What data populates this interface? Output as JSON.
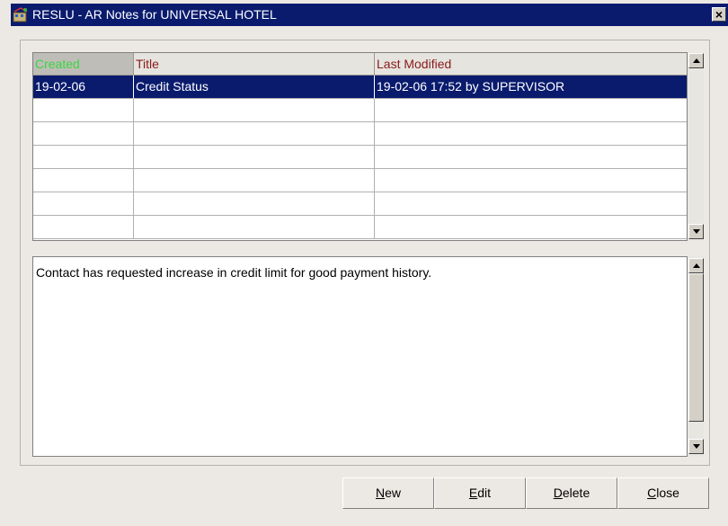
{
  "window": {
    "title": "RESLU - AR Notes for UNIVERSAL HOTEL",
    "close_glyph": "×"
  },
  "grid": {
    "columns": [
      "Created",
      "Title",
      "Last Modified"
    ],
    "sorted_column": "Created",
    "rows": [
      {
        "created": "19-02-06",
        "title": "Credit Status",
        "last_modified": "19-02-06 17:52 by SUPERVISOR",
        "selected": true
      },
      {
        "created": "",
        "title": "",
        "last_modified": ""
      },
      {
        "created": "",
        "title": "",
        "last_modified": ""
      },
      {
        "created": "",
        "title": "",
        "last_modified": ""
      },
      {
        "created": "",
        "title": "",
        "last_modified": ""
      },
      {
        "created": "",
        "title": "",
        "last_modified": ""
      },
      {
        "created": "",
        "title": "",
        "last_modified": ""
      }
    ]
  },
  "note": {
    "text": "Contact has requested increase in credit limit for good payment history."
  },
  "buttons": {
    "new": {
      "mnemonic": "N",
      "rest": "ew"
    },
    "edit": {
      "mnemonic": "E",
      "rest": "dit"
    },
    "delete": {
      "mnemonic": "D",
      "rest": "elete"
    },
    "close": {
      "mnemonic": "C",
      "rest": "lose"
    }
  },
  "colors": {
    "title_bar": "#0a1b6e",
    "selection": "#0a1b6e",
    "header_text": "#8a1b1b",
    "sorted_header_text": "#3bd640"
  }
}
